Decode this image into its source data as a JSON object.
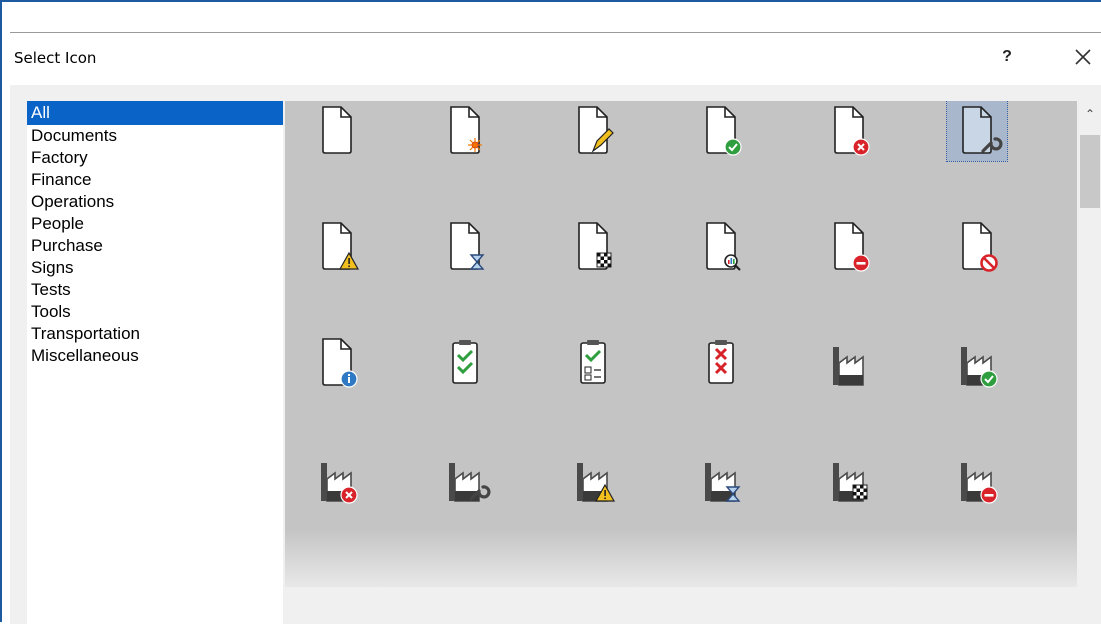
{
  "dialog": {
    "title": "Select Icon",
    "help_label": "?",
    "close_icon": "close-icon"
  },
  "categories": {
    "selected": "All",
    "items": [
      "All",
      "Documents",
      "Factory",
      "Finance",
      "Operations",
      "People",
      "Purchase",
      "Signs",
      "Tests",
      "Tools",
      "Transportation",
      "Miscellaneous"
    ]
  },
  "icons": {
    "selected": "document-wrench-icon",
    "rows": [
      [
        "document-icon",
        "document-new-icon",
        "document-edit-icon",
        "document-check-icon",
        "document-error-icon",
        "document-wrench-icon"
      ],
      [
        "document-warning-icon",
        "document-hourglass-icon",
        "document-checkered-flag-icon",
        "document-search-icon",
        "document-minus-icon",
        "document-blocked-icon"
      ],
      [
        "document-info-icon",
        "clipboard-checks-icon",
        "clipboard-checklist-icon",
        "clipboard-crosses-icon",
        "factory-icon",
        "factory-check-icon"
      ],
      [
        "factory-error-icon",
        "factory-wrench-icon",
        "factory-warning-icon",
        "factory-hourglass-icon",
        "factory-checkered-flag-icon",
        "factory-minus-icon"
      ]
    ]
  },
  "colors": {
    "selection_blue": "#0a64c8",
    "panel_gray": "#c4c4c4",
    "check_green": "#2e9e3e",
    "error_red": "#d8232a",
    "warning_yellow": "#f2c01e",
    "info_blue": "#2f78c4",
    "window_border": "#1e5aa0"
  }
}
